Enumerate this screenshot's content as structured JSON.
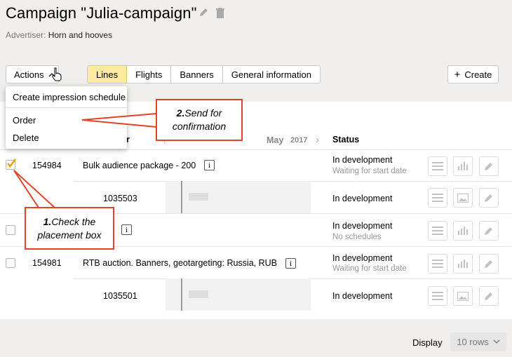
{
  "header": {
    "title": "Campaign \"Julia-campaign\"",
    "advertiser_label": "Advertiser:",
    "advertiser_value": "Horn and hooves"
  },
  "toolbar": {
    "actions_label": "Actions",
    "tabs": [
      "Lines",
      "Flights",
      "Banners",
      "General information"
    ],
    "active_tab": "Lines",
    "create_label": "Create"
  },
  "actions_menu": {
    "items": [
      "Create impression schedule",
      "Order",
      "Delete"
    ]
  },
  "table": {
    "col_number": "er",
    "month": "May",
    "year": "2017",
    "status_header": "Status",
    "rows": [
      {
        "id": "154984",
        "name": "Bulk audience package - 200",
        "status": "In development",
        "substatus": "Waiting for start date",
        "checked": true
      },
      {
        "id": "1035503",
        "status": "In development"
      },
      {
        "id": "",
        "name": "",
        "status": "In development",
        "substatus": "No schedules",
        "checked": false
      },
      {
        "id": "154981",
        "name": "RTB auction. Banners, geotargeting: Russia, RUB",
        "status": "In development",
        "substatus": "Waiting for start date",
        "checked": false
      },
      {
        "id": "1035501",
        "status": "In development"
      }
    ]
  },
  "footer": {
    "display_label": "Display",
    "rows_value": "10 rows"
  },
  "callouts": {
    "c2_num": "2.",
    "c2_text_a": "Send for",
    "c2_text_b": "confirmation",
    "c1_num": "1.",
    "c1_text_a": "Check the",
    "c1_text_b": "placement box"
  },
  "colors": {
    "accent_tab": "#ffeba0",
    "callout_border": "#e0452a",
    "checkbox_check": "#e8a300"
  }
}
